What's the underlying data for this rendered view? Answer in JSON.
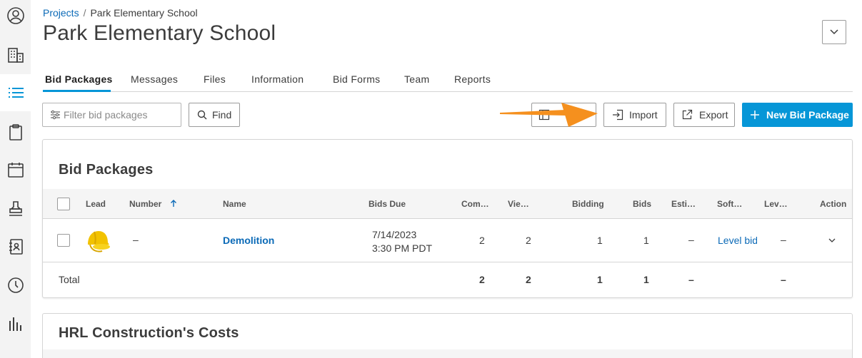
{
  "breadcrumb": {
    "root": "Projects",
    "separator": "/",
    "current": "Park Elementary School"
  },
  "page": {
    "title": "Park Elementary School"
  },
  "rail": {
    "items": [
      {
        "icon": "user-circle-icon"
      },
      {
        "icon": "building-icon"
      },
      {
        "icon": "list-icon",
        "active": true
      },
      {
        "icon": "clipboard-icon"
      },
      {
        "icon": "calendar-icon"
      },
      {
        "icon": "stamp-icon"
      },
      {
        "icon": "address-book-icon"
      },
      {
        "icon": "clock-icon"
      },
      {
        "icon": "bar-chart-icon"
      }
    ]
  },
  "tabs": [
    {
      "label": "Bid Packages",
      "active": true
    },
    {
      "label": "Messages"
    },
    {
      "label": "Files"
    },
    {
      "label": "Information"
    },
    {
      "label": "Bid Forms"
    },
    {
      "label": "Team"
    },
    {
      "label": "Reports"
    }
  ],
  "toolbar": {
    "filter_placeholder": "Filter bid packages",
    "find_label": "Find",
    "import_label": "Import",
    "export_label": "Export",
    "new_label": "New Bid Package",
    "accent_color": "#0696d7",
    "arrow_color": "#f5901e"
  },
  "bid_packages": {
    "title": "Bid Packages",
    "columns": {
      "lead": "Lead",
      "number": "Number",
      "name": "Name",
      "bids_due": "Bids Due",
      "committed": "Com…",
      "viewed": "Vie…",
      "bidding": "Bidding",
      "bids": "Bids",
      "estimate": "Esti…",
      "software": "Soft…",
      "leveled": "Lev…",
      "action": "Action"
    },
    "rows": [
      {
        "number": "–",
        "name": "Demolition",
        "bids_due_date": "7/14/2023",
        "bids_due_time": "3:30 PM PDT",
        "committed": "2",
        "viewed": "2",
        "bidding": "1",
        "bids": "1",
        "estimate": "–",
        "software": "Level bid",
        "leveled": "–"
      }
    ],
    "total": {
      "label": "Total",
      "committed": "2",
      "viewed": "2",
      "bidding": "1",
      "bids": "1",
      "estimate": "–",
      "leveled": "–"
    }
  },
  "costs": {
    "title": "HRL Construction's Costs"
  }
}
